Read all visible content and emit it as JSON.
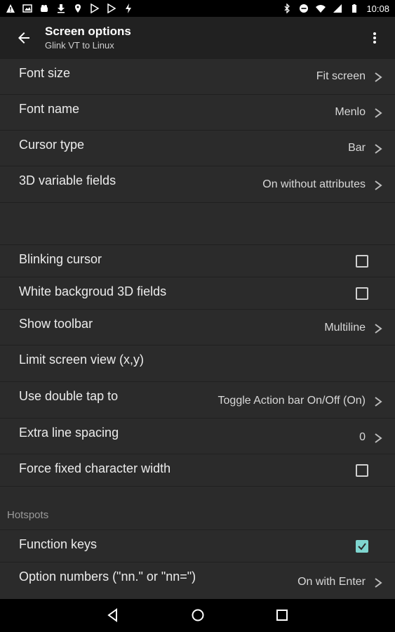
{
  "statusbar": {
    "time": "10:08"
  },
  "appbar": {
    "title": "Screen options",
    "subtitle": "Glink VT to Linux"
  },
  "rows": [
    {
      "label": "Font size",
      "value": "Fit screen"
    },
    {
      "label": "Font name",
      "value": "Menlo"
    },
    {
      "label": "Cursor type",
      "value": "Bar"
    },
    {
      "label": "3D variable fields",
      "value": "On without attributes"
    },
    {
      "label": "Blinking cursor",
      "checked": false
    },
    {
      "label": "White backgroud 3D fields",
      "checked": false
    },
    {
      "label": "Show toolbar",
      "value": "Multiline"
    },
    {
      "label": "Limit screen view (x,y)"
    },
    {
      "label": "Use double tap to",
      "value": "Toggle Action bar On/Off (On)"
    },
    {
      "label": "Extra  line spacing",
      "value": "0"
    },
    {
      "label": "Force fixed character width",
      "checked": false
    },
    {
      "label": "Function keys",
      "checked": true
    },
    {
      "label": "Option numbers (\"nn.\" or \"nn=\")",
      "value": "On with Enter"
    }
  ],
  "section": {
    "hotspots": "Hotspots"
  },
  "colors": {
    "accent": "#7fd6d0",
    "background": "#2b2b2b",
    "appbar": "#212121"
  }
}
